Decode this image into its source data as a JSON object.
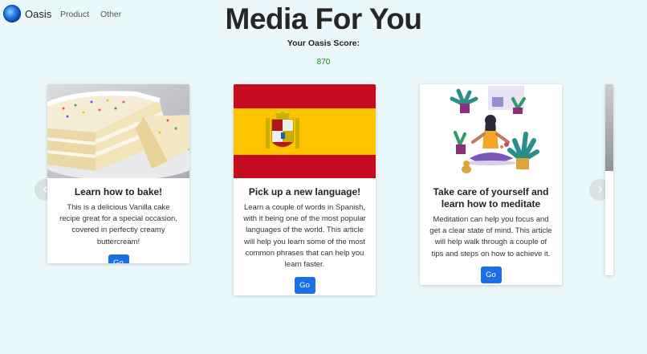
{
  "nav": {
    "brand": "Oasis",
    "links": [
      "Product",
      "Other"
    ]
  },
  "header": {
    "title": "Media For You",
    "score_label": "Your Oasis Score:",
    "score_value": "870"
  },
  "cards": [
    {
      "title": "Learn how to bake!",
      "text": "This is a delicious Vanilla cake recipe great for a special occasion, covered in perfectly creamy buttercream!",
      "button": "Go",
      "image": "vanilla-cake-photo"
    },
    {
      "title": "Pick up a new language!",
      "text": "Learn a couple of words in Spanish, with it being one of the most popular languages of the world. This article will help you learn some of the most common phrases that can help you learn faster.",
      "button": "Go",
      "image": "spanish-flag"
    },
    {
      "title": "Take care of yourself and learn how to meditate",
      "text": "Meditation can help you focus and get a clear state of mind. This article will help walk through a couple of tips and steps on how to achieve it.",
      "button": "Go",
      "image": "meditation-illustration"
    }
  ],
  "carousel": {
    "prev_icon": "chevron-left-icon",
    "next_icon": "chevron-right-icon"
  },
  "colors": {
    "background": "#eaf8fb",
    "button": "#1a6fe6",
    "score": "#1a8a1a",
    "flag_red": "#c60b1e",
    "flag_yellow": "#ffc400"
  }
}
